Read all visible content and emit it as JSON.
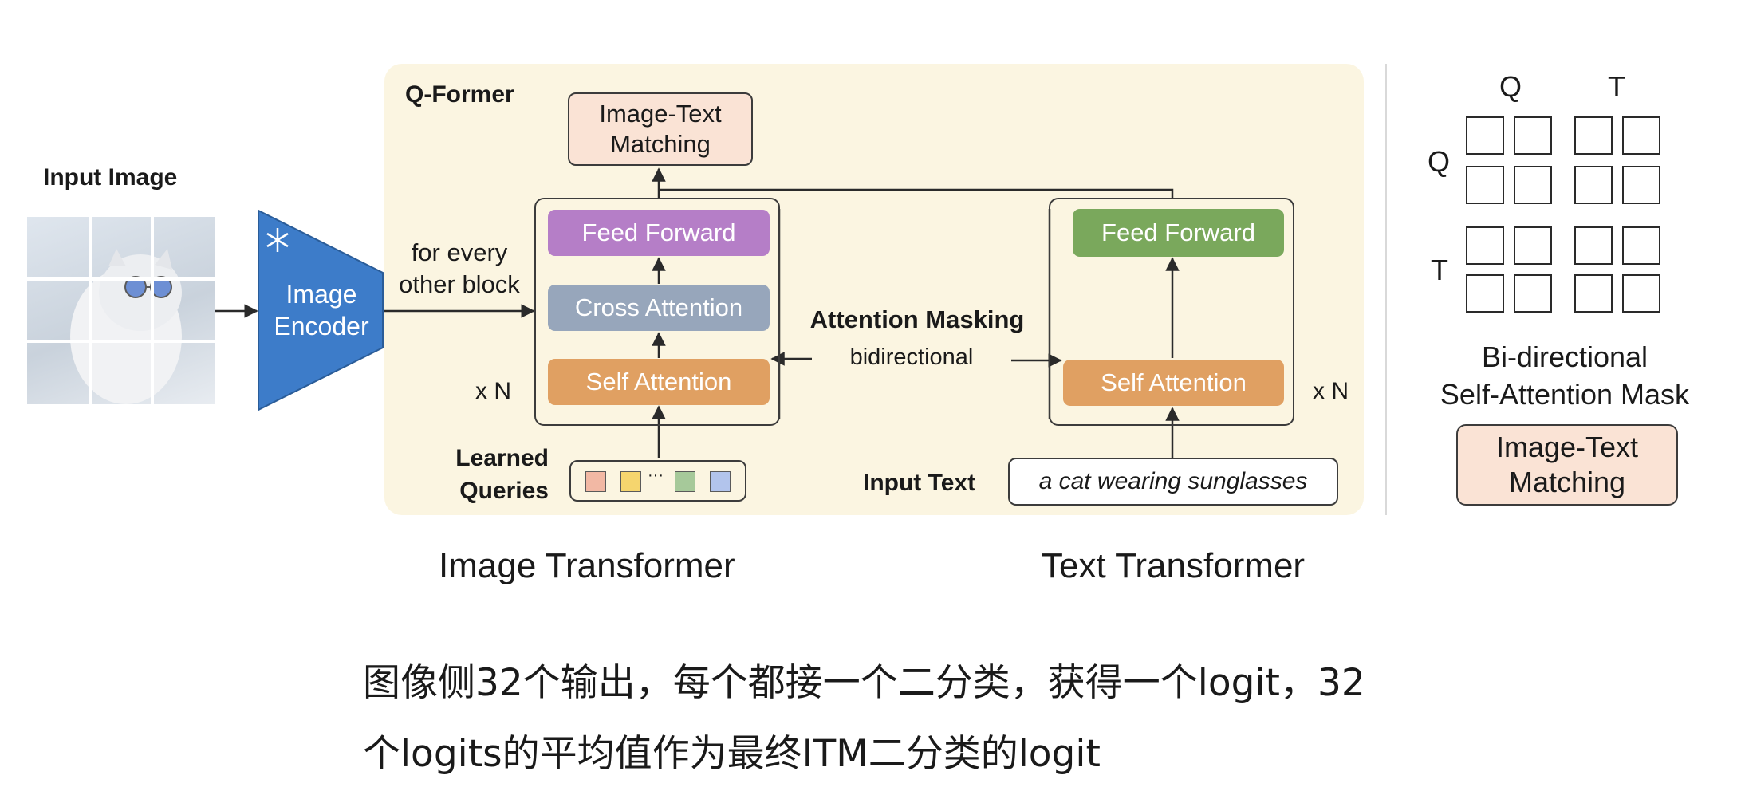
{
  "diagram": {
    "input_image_label": "Input Image",
    "image_encoder_label": "Image\nEncoder",
    "for_every_label": "for every\nother block",
    "qformer_label": "Q-Former",
    "itm_top_label": "Image-Text\nMatching",
    "feed_forward_left": "Feed Forward",
    "cross_attention": "Cross Attention",
    "self_attention_left": "Self Attention",
    "xn_left": "x N",
    "attention_masking": "Attention Masking",
    "bidirectional": "bidirectional",
    "feed_forward_right": "Feed Forward",
    "self_attention_right": "Self Attention",
    "xn_right": "x N",
    "learned_queries": "Learned\nQueries",
    "input_text_label": "Input Text",
    "input_text_value": "a cat wearing sunglasses",
    "query_ellipsis": "···",
    "mask_q_top": "Q",
    "mask_t_top": "T",
    "mask_q_left": "Q",
    "mask_t_left": "T",
    "mask_caption": "Bi-directional\nSelf-Attention Mask",
    "itm_right_label": "Image-Text\nMatching"
  },
  "captions": {
    "image_transformer": "Image Transformer",
    "text_transformer": "Text Transformer"
  },
  "subtitle": {
    "line1": "图像侧32个输出，每个都接一个二分类，获得一个logit，32",
    "line2": "个logits的平均值作为最终ITM二分类的logit"
  },
  "colors": {
    "panel_bg": "#fbf5e1",
    "encoder_blue": "#3d7cc9",
    "feed_forward_purple": "#b57ec7",
    "cross_attention_gray": "#97a6bb",
    "self_attention_orange": "#e0a062",
    "feed_forward_green": "#7aa85c",
    "itm_peach": "#fae3d5",
    "query_colors": [
      "#f2b8a4",
      "#f5d56e",
      "#a6c99a",
      "#b2c4ec"
    ]
  }
}
